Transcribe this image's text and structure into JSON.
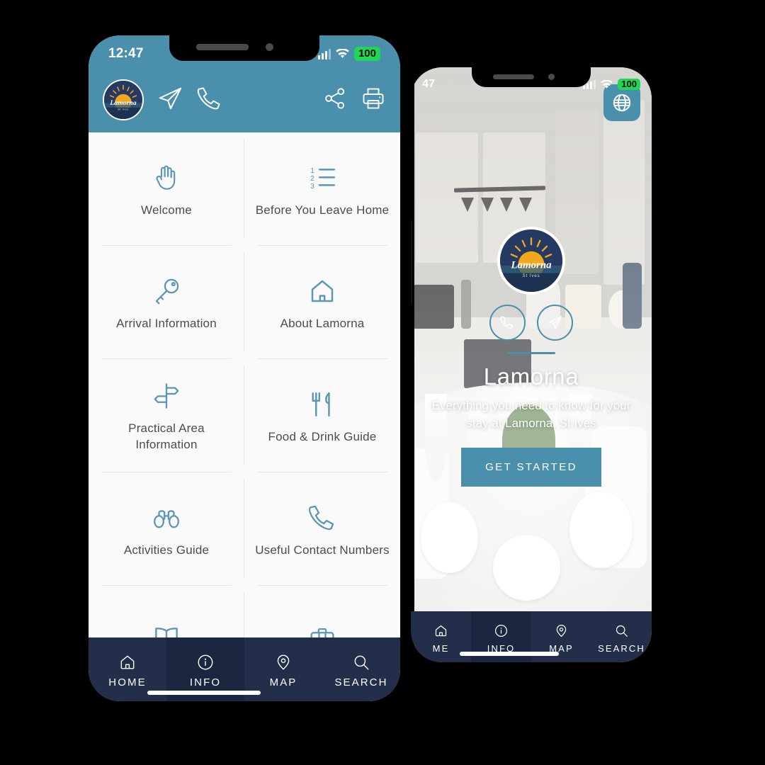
{
  "phone_left": {
    "status": {
      "time": "12:47",
      "battery": "100",
      "signal_icon": "cellular-bars-icon",
      "wifi_icon": "wifi-icon"
    },
    "header": {
      "logo_alt": "Lamorna",
      "logo_text": "Lamorna",
      "logo_sub": "St Ives",
      "actions_left": [
        {
          "name": "send-message-icon",
          "label": "Send Message"
        },
        {
          "name": "phone-call-icon",
          "label": "Call"
        }
      ],
      "actions_right": [
        {
          "name": "share-icon",
          "label": "Share"
        },
        {
          "name": "print-icon",
          "label": "Print"
        }
      ]
    },
    "menu": [
      {
        "label": "Welcome",
        "icon": "hand-wave-icon"
      },
      {
        "label": "Before You Leave Home",
        "icon": "numbered-list-icon"
      },
      {
        "label": "Arrival Information",
        "icon": "key-icon"
      },
      {
        "label": "About Lamorna",
        "icon": "house-icon"
      },
      {
        "label": "Practical Area Information",
        "icon": "signpost-icon"
      },
      {
        "label": "Food & Drink Guide",
        "icon": "fork-knife-icon"
      },
      {
        "label": "Activities Guide",
        "icon": "binoculars-icon"
      },
      {
        "label": "Useful Contact Numbers",
        "icon": "phone-icon"
      },
      {
        "label": "",
        "icon": "open-book-icon"
      },
      {
        "label": "",
        "icon": "suitcase-icon"
      }
    ],
    "tabs": [
      {
        "label": "HOME",
        "icon": "home-icon",
        "active": false
      },
      {
        "label": "INFO",
        "icon": "info-circle-icon",
        "active": true
      },
      {
        "label": "MAP",
        "icon": "map-pin-icon",
        "active": false
      },
      {
        "label": "SEARCH",
        "icon": "search-icon",
        "active": false
      }
    ]
  },
  "phone_right": {
    "status": {
      "time": "47",
      "battery": "100",
      "signal_icon": "cellular-bars-icon",
      "wifi_icon": "wifi-icon"
    },
    "language_button": {
      "icon": "globe-icon",
      "label": "Language"
    },
    "hero": {
      "logo_text": "Lamorna",
      "logo_sub": "St Ives",
      "title": "Lamorna",
      "subtitle": "Everything you need to know for your stay at Lamorna, St Ives",
      "cta_label": "GET STARTED",
      "actions": [
        {
          "name": "phone-call-icon",
          "label": "Call"
        },
        {
          "name": "send-message-icon",
          "label": "Send Message"
        }
      ]
    },
    "tabs": [
      {
        "label": "ME",
        "icon": "home-icon",
        "active": false
      },
      {
        "label": "INFO",
        "icon": "info-circle-icon",
        "active": true
      },
      {
        "label": "MAP",
        "icon": "map-pin-icon",
        "active": false
      },
      {
        "label": "SEARCH",
        "icon": "search-icon",
        "active": false
      }
    ]
  },
  "colors": {
    "header_blue": "#4a8fab",
    "navy": "#232f4a",
    "navy_active": "#1b2640",
    "icon_blue": "#5b96b8",
    "battery_green": "#1fd655",
    "logo_navy": "#243a63",
    "logo_sun": "#f2a81d"
  }
}
